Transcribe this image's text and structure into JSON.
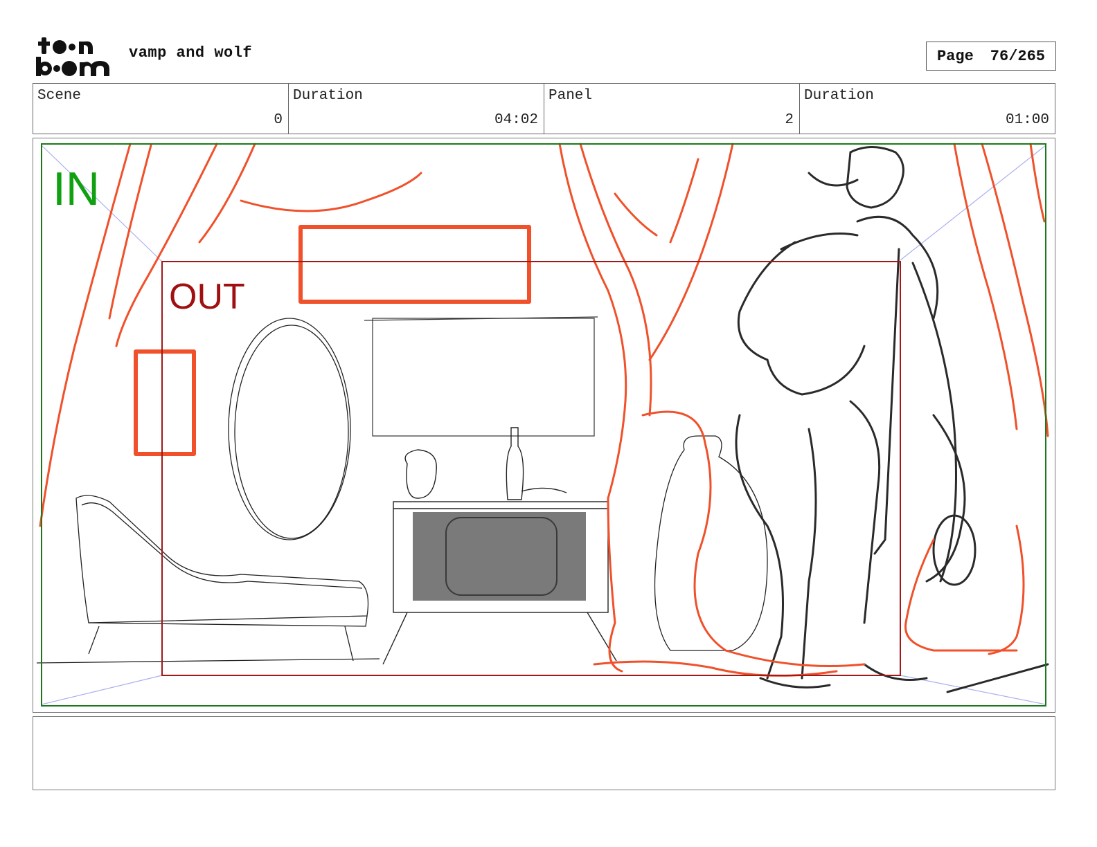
{
  "header": {
    "logo_text": "toonboom",
    "project_title": "vamp and wolf",
    "page_label": "Page",
    "page_number": "76/265"
  },
  "info_bar": {
    "scene_label": "Scene",
    "scene_value": "0",
    "scene_duration_label": "Duration",
    "scene_duration_value": "04:02",
    "panel_label": "Panel",
    "panel_value": "2",
    "panel_duration_label": "Duration",
    "panel_duration_value": "01:00"
  },
  "panel": {
    "in_label": "IN",
    "out_label": "OUT",
    "colors": {
      "in_frame": "#1a7a1a",
      "in_text": "#10a010",
      "out_frame": "#a01818",
      "out_text": "#a01010",
      "curtain_sketch": "#f0502a",
      "pencil_sketch": "#222222",
      "tv_screen": "#7a7a7a"
    }
  },
  "caption": {
    "text": ""
  }
}
